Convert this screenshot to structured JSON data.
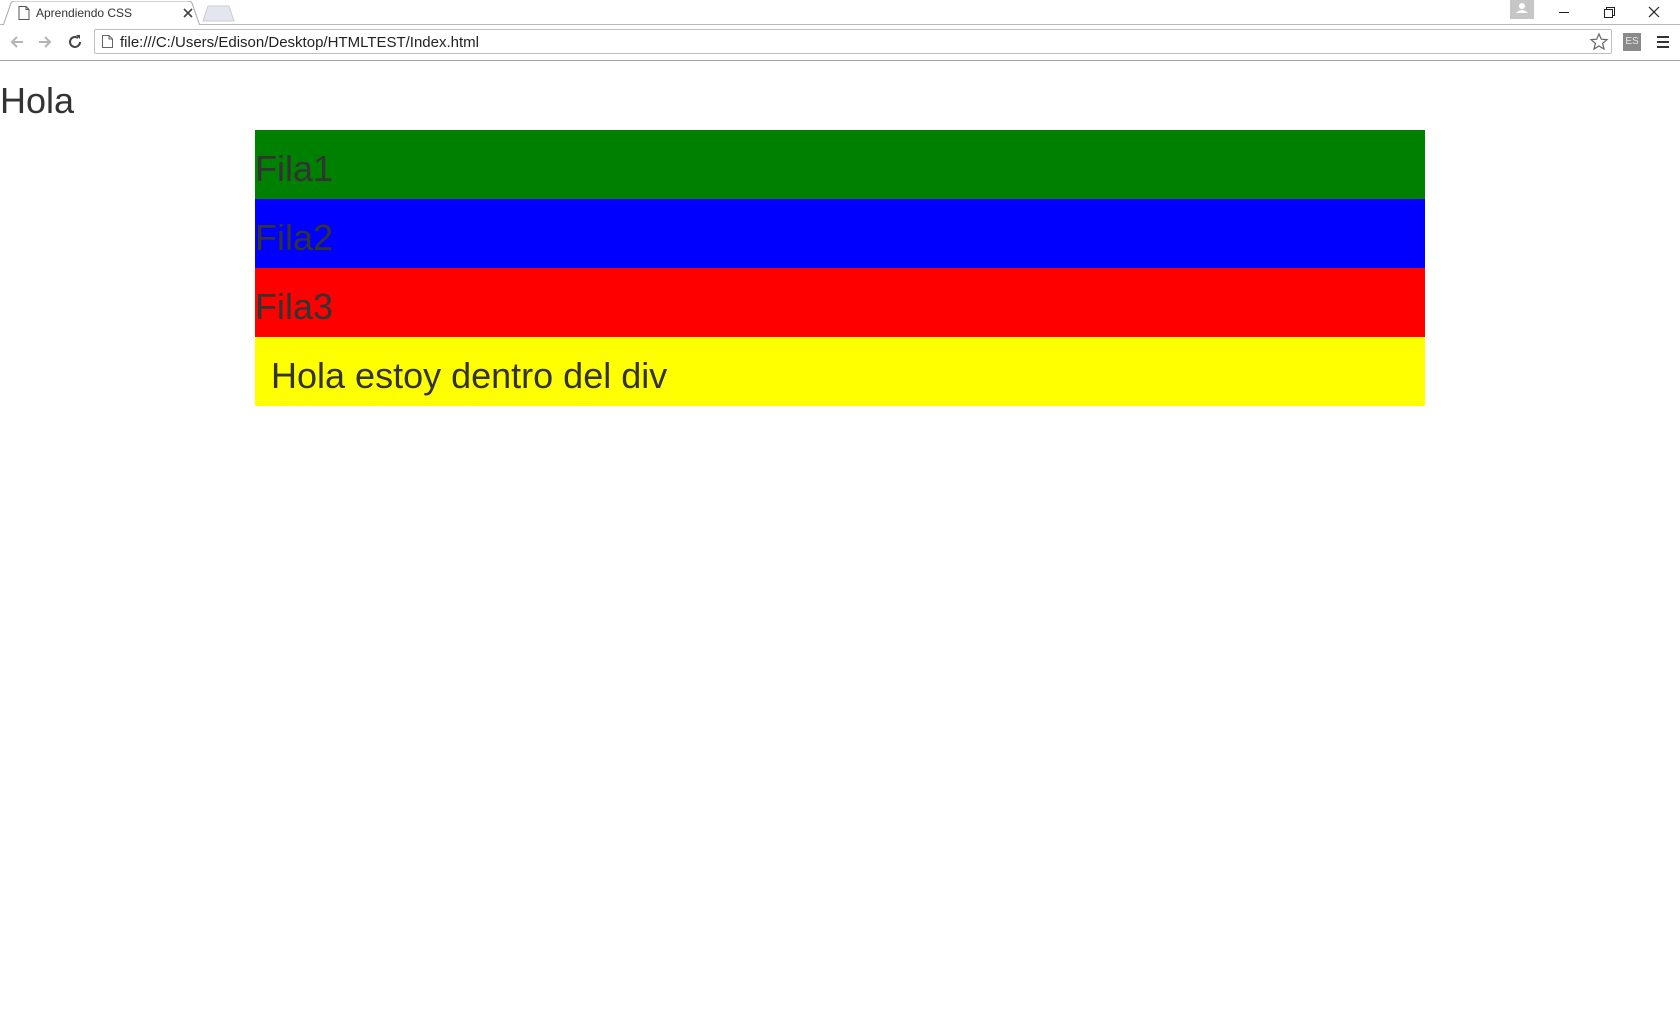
{
  "browser": {
    "tab_title": "Aprendiendo CSS",
    "url": "file:///C:/Users/Edison/Desktop/HTMLTEST/Index.html",
    "extension_label": "ES"
  },
  "page": {
    "heading": "Hola",
    "rows": [
      {
        "label": "Fila1",
        "color": "#008000"
      },
      {
        "label": "Fila2",
        "color": "#0000ff"
      },
      {
        "label": "Fila3",
        "color": "#ff0000"
      },
      {
        "label": "Hola estoy dentro del div",
        "color": "#ffff00"
      }
    ]
  }
}
